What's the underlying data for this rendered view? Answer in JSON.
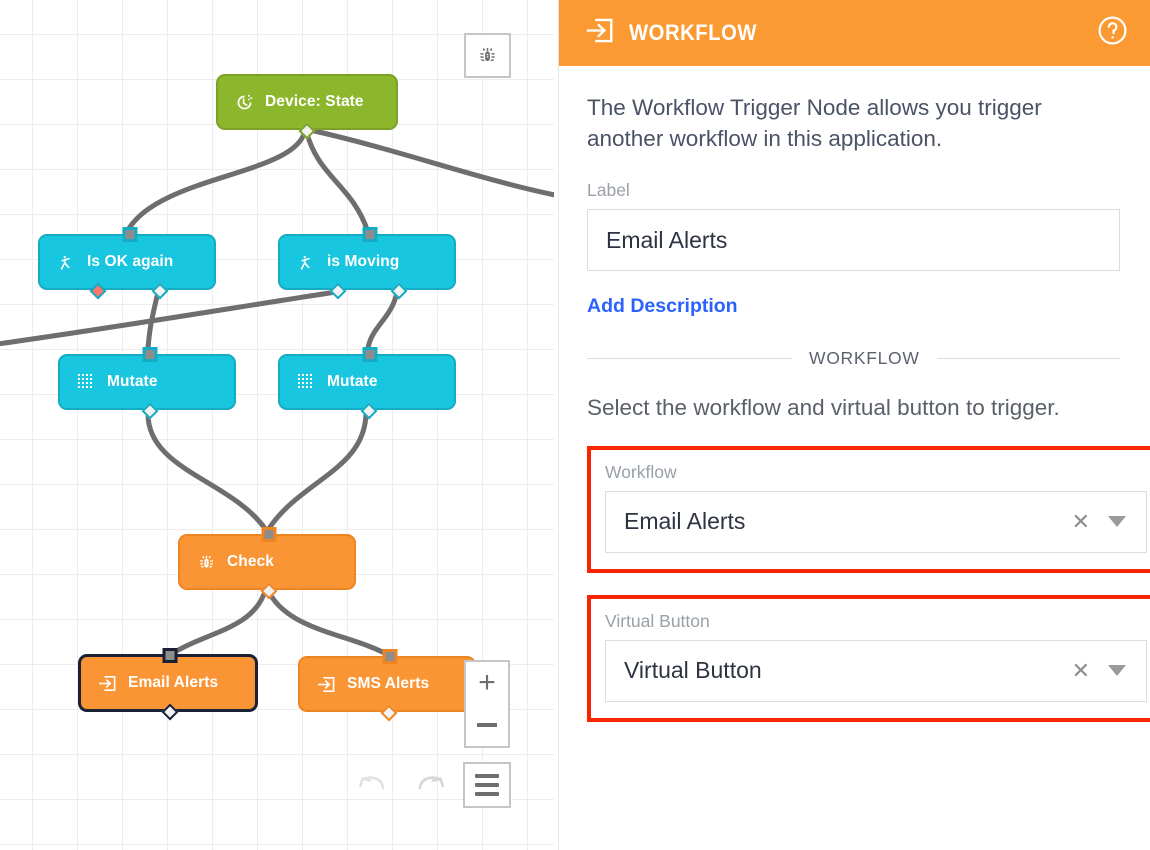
{
  "panel": {
    "header": {
      "title": "WORKFLOW",
      "icon": "enter-arrow-icon",
      "help_icon": "help-circle-icon",
      "background": "#fb9a33"
    },
    "description": "The Workflow Trigger Node allows you trigger another workflow in this application.",
    "label_field": {
      "label": "Label",
      "value": "Email Alerts"
    },
    "add_description_link": "Add Description",
    "section_divider": "WORKFLOW",
    "section_description": "Select the workflow and virtual button to trigger.",
    "workflow_select": {
      "label": "Workflow",
      "value": "Email Alerts",
      "clear_icon": "close-x-icon",
      "caret_icon": "caret-down-icon",
      "highlight_color": "#f92400"
    },
    "virtual_button_select": {
      "label": "Virtual Button",
      "value": "Virtual Button",
      "clear_icon": "close-x-icon",
      "caret_icon": "caret-down-icon",
      "highlight_color": "#f92400"
    }
  },
  "canvas": {
    "debug_button_icon": "bug-icon",
    "zoom_in_label": "+",
    "zoom_out_label": "−",
    "menu_icon": "hamburger-icon",
    "undo_icon": "undo-arrow-icon",
    "redo_icon": "redo-arrow-icon",
    "nodes": [
      {
        "id": "device-state",
        "label": "Device: State",
        "icon": "timer-gear-icon",
        "color": "#8cb62c",
        "type": "trigger",
        "selected": false
      },
      {
        "id": "is-ok-again",
        "label": "Is OK again",
        "icon": "branch-person-icon",
        "color": "#18c6e0",
        "type": "condition",
        "selected": false
      },
      {
        "id": "is-moving",
        "label": "is Moving",
        "icon": "branch-person-icon",
        "color": "#18c6e0",
        "type": "condition",
        "selected": false
      },
      {
        "id": "mutate-1",
        "label": "Mutate",
        "icon": "grid-dots-icon",
        "color": "#18c6e0",
        "type": "mutate",
        "selected": false
      },
      {
        "id": "mutate-2",
        "label": "Mutate",
        "icon": "grid-dots-icon",
        "color": "#18c6e0",
        "type": "mutate",
        "selected": false
      },
      {
        "id": "check",
        "label": "Check",
        "icon": "bug-icon",
        "color": "#fa9536",
        "type": "debug",
        "selected": false
      },
      {
        "id": "email-alerts",
        "label": "Email Alerts",
        "icon": "enter-arrow-icon",
        "color": "#fa9536",
        "type": "workflow-trigger",
        "selected": true
      },
      {
        "id": "sms-alerts",
        "label": "SMS Alerts",
        "icon": "enter-arrow-icon",
        "color": "#fa9536",
        "type": "workflow-trigger",
        "selected": false
      }
    ]
  }
}
